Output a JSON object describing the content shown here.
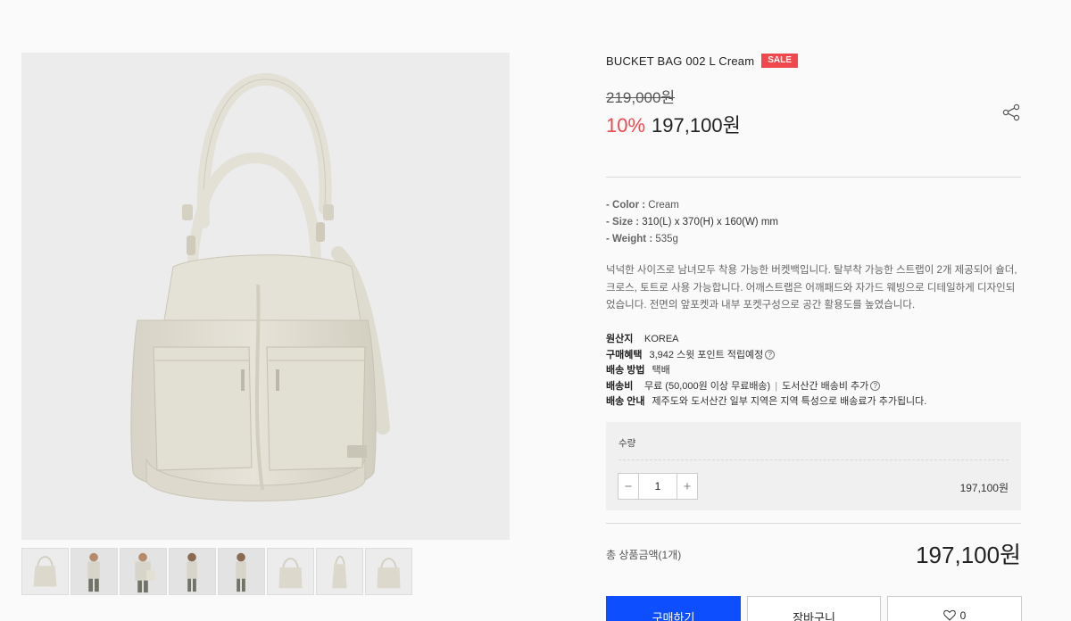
{
  "gallery": {
    "main_image_alt": "cream bucket bag",
    "thumbnail_count": 8
  },
  "product": {
    "title": "BUCKET BAG 002 L Cream",
    "badge": "SALE",
    "original_price": "219,000원",
    "discount": "10%",
    "sale_price": "197,100원"
  },
  "specs": [
    {
      "key": "- Color : ",
      "value": "Cream"
    },
    {
      "key": "- Size : ",
      "value": "310(L) x 370(H) x 160(W) mm"
    },
    {
      "key": "- Weight : ",
      "value": "535g"
    }
  ],
  "description": [
    "넉넉한 사이즈로 남녀모두 착용 가능한 버켓백입니다. 탈부착 가능한 스트랩이 2개 제공되어 숄더,",
    "크로스, 토트로 사용 가능합니다. 어깨스트랩은 어깨패드와 자가드 웨빙으로 디테일하게 디자인되",
    "었습니다. 전면의 앞포켓과 내부 포켓구성으로 공간 활용도를 높였습니다."
  ],
  "delivery": {
    "origin_label": "원산지",
    "origin_value": "KOREA",
    "benefit_label": "구매혜택",
    "benefit_value": "3,942 스윗 포인트 적립예정",
    "method_label": "배송 방법",
    "method_value": "택배",
    "fee_label": "배송비",
    "fee_value": "무료 (50,000원 이상 무료배송)",
    "fee_extra": "도서산간 배송비 추가",
    "guide_label": "배송 안내",
    "guide_value": "제주도와 도서산간 일부 지역은 지역 특성으로 배송료가 추가됩니다."
  },
  "quantity": {
    "label": "수량",
    "minus": "−",
    "value": "1",
    "plus": "+",
    "line_price": "197,100원"
  },
  "total": {
    "label": "총 상품금액(1개)",
    "price": "197,100원"
  },
  "actions": {
    "buy": "구매하기",
    "cart": "장바구니",
    "like_count": "0"
  },
  "colors": {
    "sale": "#f0494d",
    "buy_button": "#0d4fff"
  }
}
